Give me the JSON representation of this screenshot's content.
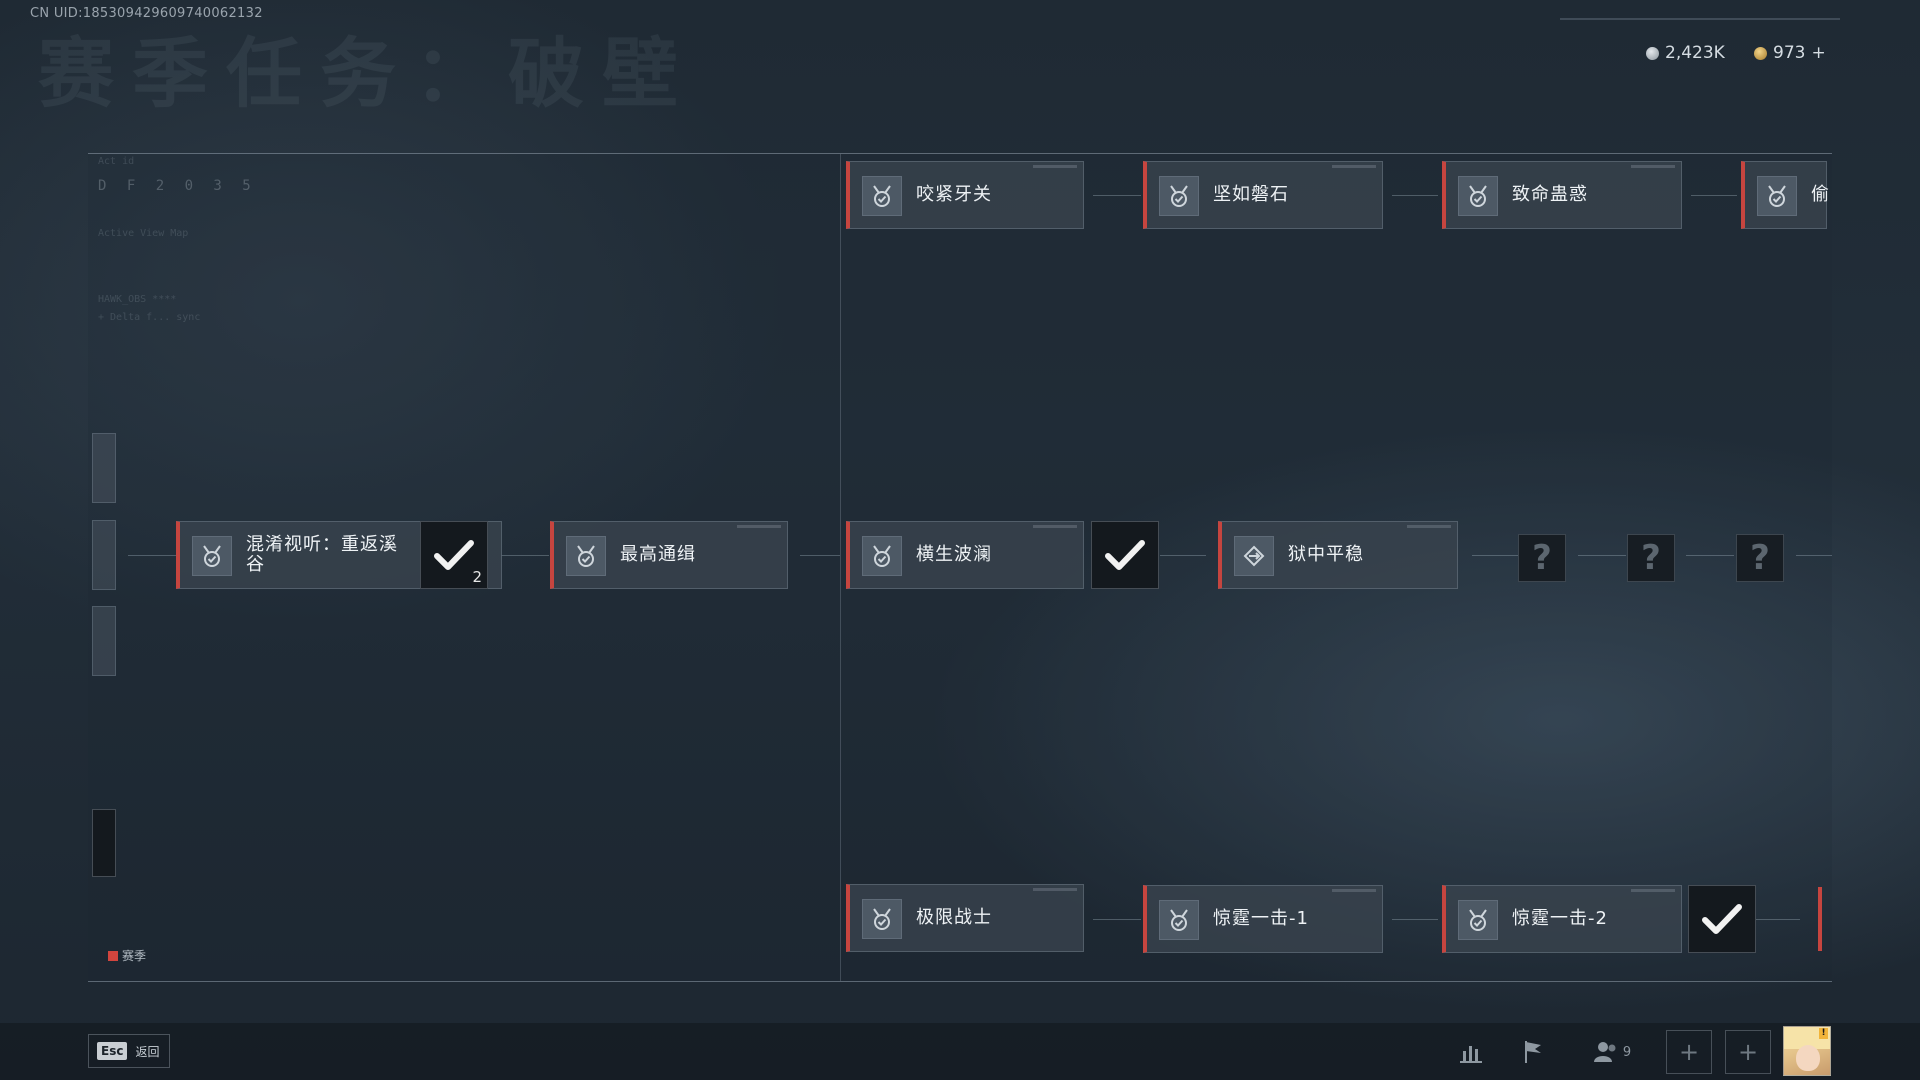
{
  "header": {
    "uid": "CN UID:18530942960974006213​2",
    "bg_title": "赛季任务：破壁",
    "currency_silver": "2,423K",
    "currency_gold": "973",
    "currency_add": "+"
  },
  "board": {
    "df_label": "D F  2  0  3  5",
    "hud_line1": "Act id",
    "hud_line2": "Active View Map",
    "hud_line3": "HAWK_OBS ****",
    "hud_line4": "+ Delta f... sync",
    "row_top": [
      "咬紧牙关",
      "坚如磐石",
      "致命蛊惑",
      "偷"
    ],
    "row_mid": [
      "混淆视听：重返溪谷",
      "最高通缉",
      "横生波澜",
      "狱中平稳"
    ],
    "row_bottom": [
      "极限战士",
      "惊霆一击-1",
      "惊霆一击-2"
    ],
    "check_count": "2",
    "unknown_mark": "?",
    "legend": "赛季"
  },
  "footer": {
    "esc_key": "Esc",
    "back_label": "返回",
    "friends_count": "9",
    "avatar_badge": "!"
  },
  "colors": {
    "accent_red": "#c6453f",
    "background": "#222e39"
  },
  "icons": [
    "medal-icon",
    "check-icon",
    "question-icon",
    "stats-icon",
    "flag-icon",
    "friends-icon",
    "plus-icon"
  ]
}
